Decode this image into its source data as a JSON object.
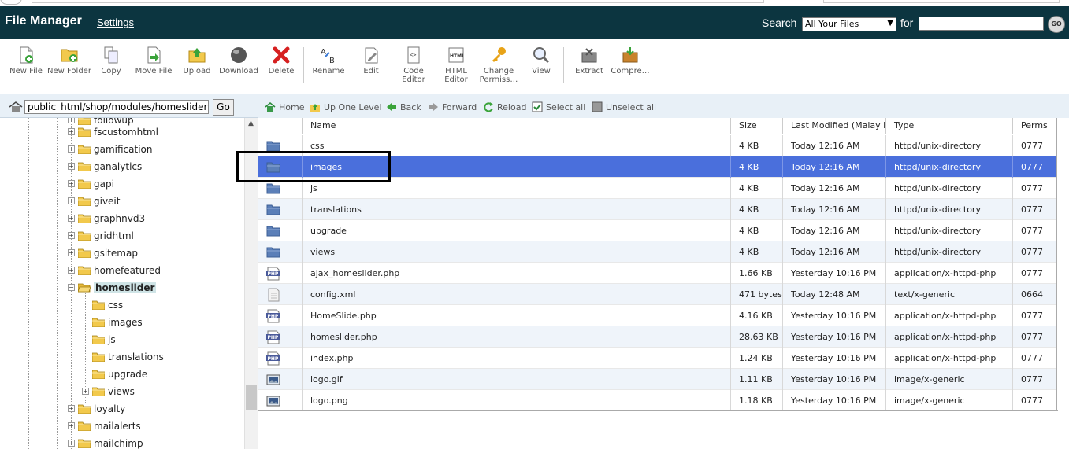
{
  "header": {
    "title": "File Manager",
    "settings_label": "Settings",
    "search_label": "Search",
    "search_scope": "All Your Files",
    "for_label": "for",
    "search_value": "",
    "go_label": "GO"
  },
  "toolbar": {
    "new_file": "New File",
    "new_folder": "New Folder",
    "copy": "Copy",
    "move_file": "Move File",
    "upload": "Upload",
    "download": "Download",
    "delete": "Delete",
    "rename": "Rename",
    "edit": "Edit",
    "code_editor": "Code Editor",
    "html_editor": "HTML Editor",
    "change_permissions": "Change Permiss…",
    "view": "View",
    "extract": "Extract",
    "compress": "Compre…"
  },
  "path": {
    "value": "public_html/shop/modules/homeslider",
    "go_label": "Go"
  },
  "nav": {
    "home": "Home",
    "up_one_level": "Up One Level",
    "back": "Back",
    "forward": "Forward",
    "reload": "Reload",
    "select_all": "Select all",
    "unselect_all": "Unselect all"
  },
  "tree": {
    "items": [
      {
        "label": "followup"
      },
      {
        "label": "fscustomhtml"
      },
      {
        "label": "gamification"
      },
      {
        "label": "ganalytics"
      },
      {
        "label": "gapi"
      },
      {
        "label": "giveit"
      },
      {
        "label": "graphnvd3"
      },
      {
        "label": "gridhtml"
      },
      {
        "label": "gsitemap"
      },
      {
        "label": "homefeatured"
      },
      {
        "label": "homeslider"
      },
      {
        "label": "css"
      },
      {
        "label": "images"
      },
      {
        "label": "js"
      },
      {
        "label": "translations"
      },
      {
        "label": "upgrade"
      },
      {
        "label": "views"
      },
      {
        "label": "loyalty"
      },
      {
        "label": "mailalerts"
      },
      {
        "label": "mailchimp"
      }
    ]
  },
  "table": {
    "columns": {
      "name": "Name",
      "size": "Size",
      "modified": "Last Modified (Malay Peninsula Standard Time)",
      "type": "Type",
      "perms": "Perms"
    },
    "rows": [
      {
        "name": "css",
        "size": "4 KB",
        "modified": "Today 12:16 AM",
        "type": "httpd/unix-directory",
        "perms": "0777",
        "icon": "folder"
      },
      {
        "name": "images",
        "size": "4 KB",
        "modified": "Today 12:16 AM",
        "type": "httpd/unix-directory",
        "perms": "0777",
        "icon": "folder"
      },
      {
        "name": "js",
        "size": "4 KB",
        "modified": "Today 12:16 AM",
        "type": "httpd/unix-directory",
        "perms": "0777",
        "icon": "folder"
      },
      {
        "name": "translations",
        "size": "4 KB",
        "modified": "Today 12:16 AM",
        "type": "httpd/unix-directory",
        "perms": "0777",
        "icon": "folder"
      },
      {
        "name": "upgrade",
        "size": "4 KB",
        "modified": "Today 12:16 AM",
        "type": "httpd/unix-directory",
        "perms": "0777",
        "icon": "folder"
      },
      {
        "name": "views",
        "size": "4 KB",
        "modified": "Today 12:16 AM",
        "type": "httpd/unix-directory",
        "perms": "0777",
        "icon": "folder"
      },
      {
        "name": "ajax_homeslider.php",
        "size": "1.66 KB",
        "modified": "Yesterday 10:16 PM",
        "type": "application/x-httpd-php",
        "perms": "0777",
        "icon": "php"
      },
      {
        "name": "config.xml",
        "size": "471 bytes",
        "modified": "Today 12:48 AM",
        "type": "text/x-generic",
        "perms": "0664",
        "icon": "text"
      },
      {
        "name": "HomeSlide.php",
        "size": "4.16 KB",
        "modified": "Yesterday 10:16 PM",
        "type": "application/x-httpd-php",
        "perms": "0777",
        "icon": "php"
      },
      {
        "name": "homeslider.php",
        "size": "28.63 KB",
        "modified": "Yesterday 10:16 PM",
        "type": "application/x-httpd-php",
        "perms": "0777",
        "icon": "php"
      },
      {
        "name": "index.php",
        "size": "1.24 KB",
        "modified": "Yesterday 10:16 PM",
        "type": "application/x-httpd-php",
        "perms": "0777",
        "icon": "php"
      },
      {
        "name": "logo.gif",
        "size": "1.11 KB",
        "modified": "Yesterday 10:16 PM",
        "type": "image/x-generic",
        "perms": "0777",
        "icon": "image"
      },
      {
        "name": "logo.png",
        "size": "1.18 KB",
        "modified": "Yesterday 10:16 PM",
        "type": "image/x-generic",
        "perms": "0777",
        "icon": "image"
      }
    ]
  },
  "colors": {
    "header_bg": "#0c3540",
    "selected_row": "#4a6fdc",
    "alt_row": "#eff4fa",
    "folder_blue": "#5b7fb8",
    "folder_yellow": "#f2c94c"
  }
}
